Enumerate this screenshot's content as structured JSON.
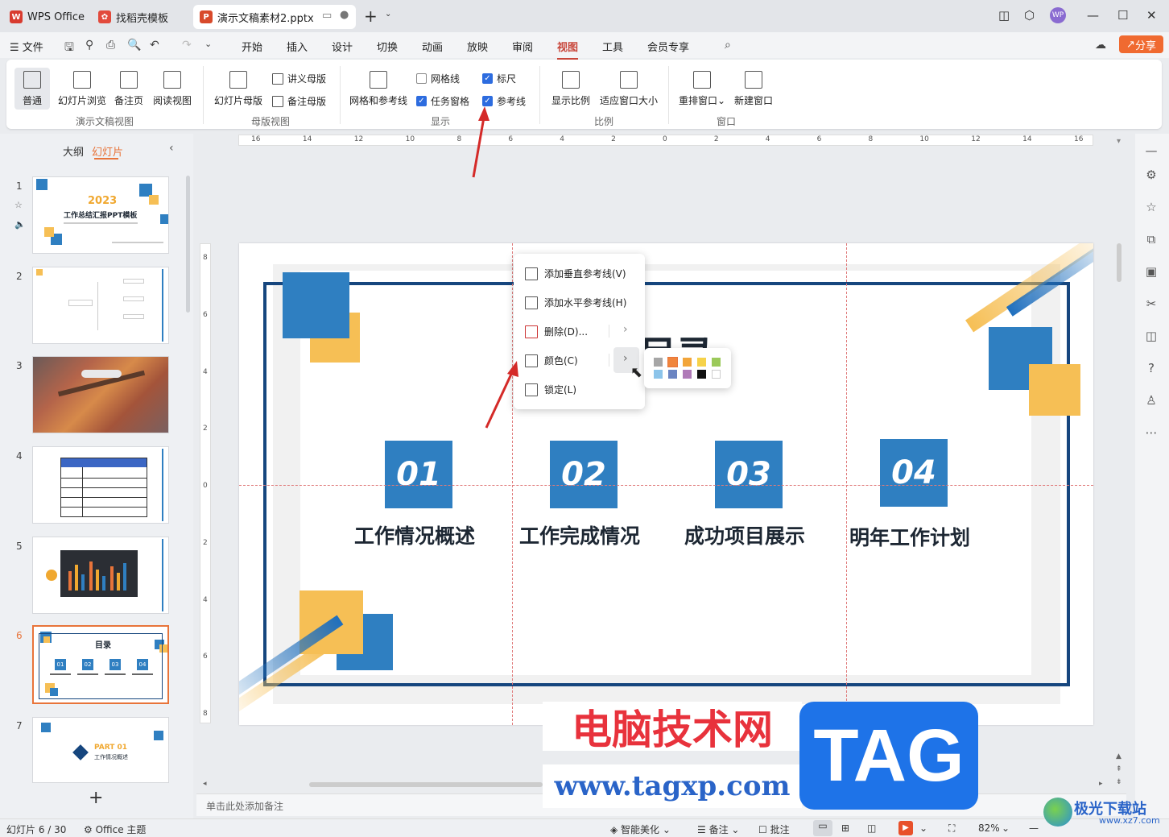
{
  "titlebar": {
    "tabs": [
      {
        "label": "WPS Office",
        "icon": "wps-logo-icon"
      },
      {
        "label": "找稻壳模板",
        "icon": "docer-icon"
      },
      {
        "label": "演示文稿素材2.pptx",
        "icon": "ppt-icon"
      }
    ],
    "avatar_text": "WP"
  },
  "menubar": {
    "file": "文件",
    "items": [
      "开始",
      "插入",
      "设计",
      "切换",
      "动画",
      "放映",
      "审阅",
      "视图",
      "工具",
      "会员专享"
    ],
    "active": "视图",
    "share": "分享"
  },
  "ribbon": {
    "g1": {
      "normal": "普通",
      "sorter": "幻灯片浏览",
      "notes_page": "备注页",
      "reading": "阅读视图",
      "label": "演示文稿视图"
    },
    "g2": {
      "slide_master": "幻灯片母版",
      "handout_master": "讲义母版",
      "notes_master": "备注母版",
      "label": "母版视图"
    },
    "g3": {
      "grid_guides": "网格和参考线",
      "gridlines": "网格线",
      "gridlines_checked": false,
      "task_pane": "任务窗格",
      "task_pane_checked": true,
      "ruler": "标尺",
      "ruler_checked": true,
      "guides": "参考线",
      "guides_checked": true,
      "label": "显示"
    },
    "g4": {
      "zoom": "显示比例",
      "fit": "适应窗口大小",
      "label": "比例"
    },
    "g5": {
      "arrange": "重排窗口",
      "new_window": "新建窗口",
      "label": "窗口"
    }
  },
  "leftpanel": {
    "tab_outline": "大纲",
    "tab_slides": "幻灯片",
    "slide_numbers": [
      "1",
      "2",
      "3",
      "4",
      "5",
      "6",
      "7"
    ],
    "selected": "6",
    "t1_year": "2023",
    "t1_title": "工作总结汇报PPT模板",
    "t6_title": "目录",
    "t6_nums": [
      "01",
      "02",
      "03",
      "04"
    ],
    "t7_part": "PART 01",
    "t7_sub": "工作情况概述"
  },
  "ruler": {
    "h_labels": [
      "16",
      "14",
      "12",
      "10",
      "8",
      "6",
      "4",
      "2",
      "0",
      "2",
      "4",
      "6",
      "8",
      "10",
      "12",
      "14",
      "16"
    ],
    "v_labels": [
      "8",
      "6",
      "4",
      "2",
      "0",
      "2",
      "4",
      "6",
      "8"
    ]
  },
  "slide": {
    "title": "目录",
    "items": [
      {
        "num": "01",
        "label": "工作情况概述"
      },
      {
        "num": "02",
        "label": "工作完成情况"
      },
      {
        "num": "03",
        "label": "成功项目展示"
      },
      {
        "num": "04",
        "label": "明年工作计划"
      }
    ]
  },
  "context_menu": {
    "add_vertical": "添加垂直参考线(V)",
    "add_horizontal": "添加水平参考线(H)",
    "delete": "删除(D)...",
    "color": "颜色(C)",
    "lock": "锁定(L)"
  },
  "palette": [
    "#a6a6a6",
    "#f0853c",
    "#f2a53a",
    "#f6d24a",
    "#9bc95a",
    "#8cc4ea",
    "#6b85c2",
    "#b07ab8",
    "#111111",
    "#ffffff"
  ],
  "notes_placeholder": "单击此处添加备注",
  "status": {
    "slide_count": "幻灯片 6 / 30",
    "theme": "Office 主题",
    "beautify": "智能美化",
    "notes": "备注",
    "comments": "批注",
    "zoom": "82%"
  },
  "watermark": {
    "cn": "电脑技术网",
    "url": "www.tagxp.com",
    "tag": "TAG",
    "site": "极光下载站",
    "site_url": "www.xz7.com"
  },
  "colors": {
    "accent": "#c8463a",
    "blue": "#2f7fc1",
    "yellow": "#f6bf55",
    "navy": "#16467e",
    "arrow": "#d42a28"
  }
}
